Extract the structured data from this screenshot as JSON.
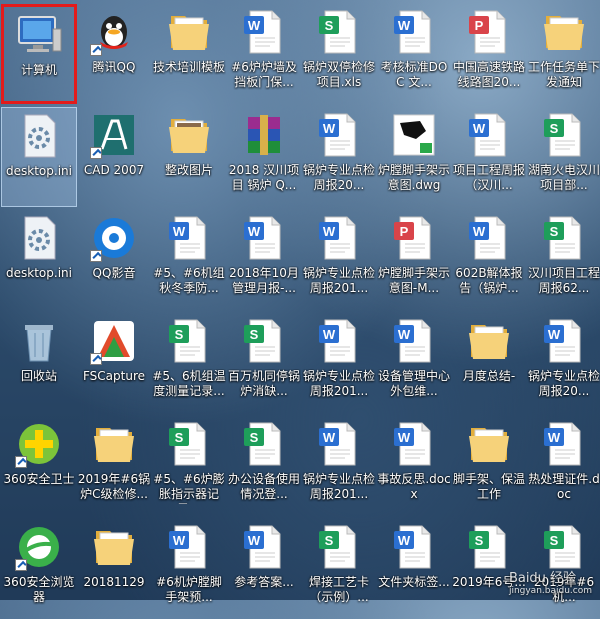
{
  "desktop": {
    "icons": [
      {
        "label": "计算机",
        "type": "computer",
        "selected": false,
        "highlight": true
      },
      {
        "label": "腾讯QQ",
        "type": "qq",
        "shortcut": true
      },
      {
        "label": "技术培训模板",
        "type": "folder"
      },
      {
        "label": "#6炉炉墙及挡板门保...",
        "type": "word"
      },
      {
        "label": "锅炉双停检修项目.xls",
        "type": "excel"
      },
      {
        "label": "考核标准DOC 文...",
        "type": "word"
      },
      {
        "label": "中国高速铁路线路图20...",
        "type": "pdf"
      },
      {
        "label": "工作任务单下发通知",
        "type": "folder"
      },
      {
        "label": "desktop.ini",
        "type": "ini",
        "selected": true
      },
      {
        "label": "CAD 2007",
        "type": "cad",
        "shortcut": true
      },
      {
        "label": "整改图片",
        "type": "folder-photo"
      },
      {
        "label": "2018 汉川项目 锅炉 Q...",
        "type": "rar"
      },
      {
        "label": "锅炉专业点检周报20...",
        "type": "word"
      },
      {
        "label": "炉膛脚手架示意图.dwg",
        "type": "dwg"
      },
      {
        "label": "项目工程周报（汉川...",
        "type": "word"
      },
      {
        "label": "湖南火电汉川项目部...",
        "type": "excel"
      },
      {
        "label": "desktop.ini",
        "type": "ini"
      },
      {
        "label": "QQ影音",
        "type": "qqplayer",
        "shortcut": true
      },
      {
        "label": "#5、#6机组秋冬季防...",
        "type": "word"
      },
      {
        "label": "2018年10月管理月报-...",
        "type": "word"
      },
      {
        "label": "锅炉专业点检周报201...",
        "type": "word"
      },
      {
        "label": "炉膛脚手架示意图-M...",
        "type": "pdf"
      },
      {
        "label": "602B解体报告（锅炉...",
        "type": "word"
      },
      {
        "label": "汉川项目工程周报62...",
        "type": "excel"
      },
      {
        "label": "回收站",
        "type": "recycle"
      },
      {
        "label": "FSCapture",
        "type": "fscapture",
        "shortcut": true
      },
      {
        "label": "#5、6机组温度测量记录...",
        "type": "excel"
      },
      {
        "label": "百万机同停锅炉消缺...",
        "type": "excel"
      },
      {
        "label": "锅炉专业点检周报201...",
        "type": "word"
      },
      {
        "label": "设备管理中心外包维...",
        "type": "word"
      },
      {
        "label": "月度总结-",
        "type": "folder"
      },
      {
        "label": "锅炉专业点检周报20...",
        "type": "word"
      },
      {
        "label": "360安全卫士",
        "type": "360safe",
        "shortcut": true
      },
      {
        "label": "2019年#6锅炉C级检修...",
        "type": "folder"
      },
      {
        "label": "#5、#6炉膨胀指示器记录...",
        "type": "excel"
      },
      {
        "label": "办公设备使用情况登...",
        "type": "excel"
      },
      {
        "label": "锅炉专业点检周报201...",
        "type": "word"
      },
      {
        "label": "事故反思.docx",
        "type": "word"
      },
      {
        "label": "脚手架、保温工作",
        "type": "folder"
      },
      {
        "label": "热处理证件.doc",
        "type": "word"
      },
      {
        "label": "360安全浏览器",
        "type": "360browser",
        "shortcut": true
      },
      {
        "label": "20181129",
        "type": "folder"
      },
      {
        "label": "#6机炉膛脚手架预...",
        "type": "word"
      },
      {
        "label": "参考答案...",
        "type": "word"
      },
      {
        "label": "焊接工艺卡（示例）...",
        "type": "excel"
      },
      {
        "label": "文件夹标签...",
        "type": "word"
      },
      {
        "label": "2019年6号...",
        "type": "excel"
      },
      {
        "label": "2019年#6机...",
        "type": "excel"
      }
    ]
  },
  "watermark": {
    "text": "Baidu 经验",
    "sub": "jingyan.baidu.com"
  },
  "colors": {
    "word": "#2b6fd1",
    "excel": "#1e9e5a",
    "pdf": "#d9444a",
    "folder": "#f2c75c",
    "highlight": "#e31b1b"
  }
}
